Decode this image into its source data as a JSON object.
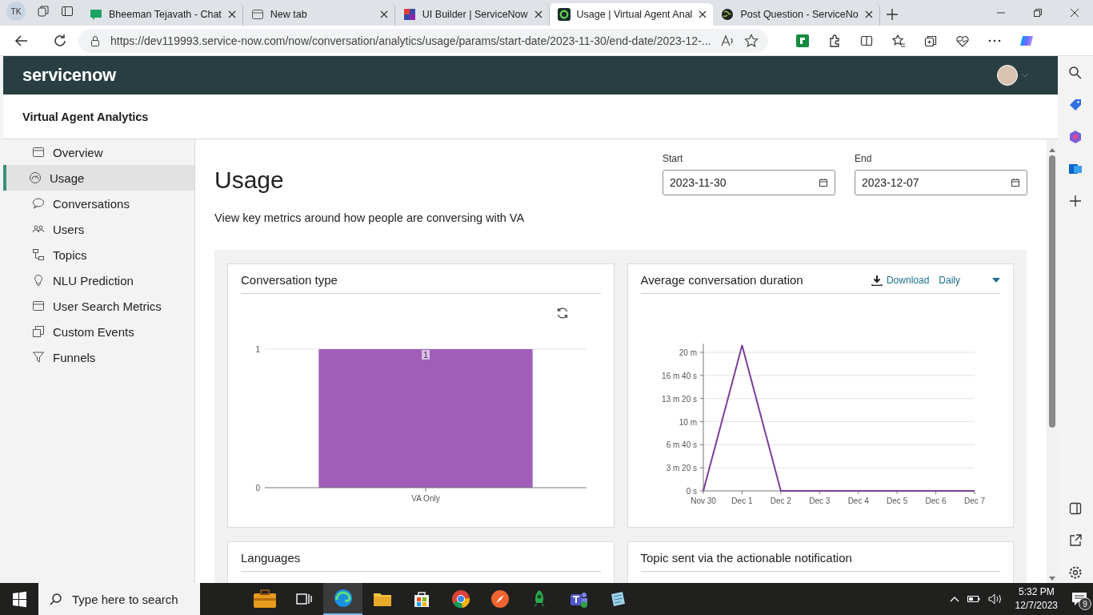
{
  "browser": {
    "profile": "TK",
    "tabs": [
      {
        "title": "Bheeman Tejavath - Chat",
        "kind": "chat",
        "selected": false
      },
      {
        "title": "New tab",
        "kind": "newtab",
        "selected": false
      },
      {
        "title": "UI Builder | ServiceNow",
        "kind": "builder",
        "selected": false
      },
      {
        "title": "Usage | Virtual Agent Anal",
        "kind": "servicenow",
        "selected": true
      },
      {
        "title": "Post Question - ServiceNo",
        "kind": "community",
        "selected": false
      }
    ],
    "address": "https://dev119993.service-now.com/now/conversation/analytics/usage/params/start-date/2023-11-30/end-date/2023-12-..."
  },
  "app": {
    "brand": "servicenow",
    "title": "Virtual Agent Analytics",
    "nav": [
      {
        "label": "Overview",
        "kind": "panel",
        "selected": false
      },
      {
        "label": "Usage",
        "kind": "gauge",
        "selected": true
      },
      {
        "label": "Conversations",
        "kind": "bubble",
        "selected": false
      },
      {
        "label": "Users",
        "kind": "users",
        "selected": false
      },
      {
        "label": "Topics",
        "kind": "topics",
        "selected": false
      },
      {
        "label": "NLU Prediction",
        "kind": "bulb",
        "selected": false
      },
      {
        "label": "User Search Metrics",
        "kind": "panel",
        "selected": false
      },
      {
        "label": "Custom Events",
        "kind": "events",
        "selected": false
      },
      {
        "label": "Funnels",
        "kind": "funnel",
        "selected": false
      }
    ],
    "page": {
      "heading": "Usage",
      "description": "View key metrics around how people are conversing with VA",
      "start": {
        "label": "Start",
        "value": "2023-11-30"
      },
      "end": {
        "label": "End",
        "value": "2023-12-07"
      }
    },
    "cards": [
      {
        "title": "Conversation type",
        "chart_data": {
          "type": "bar",
          "categories": [
            "VA Only"
          ],
          "series": [
            {
              "color": "#a05eb8",
              "values": [
                1
              ]
            }
          ],
          "ylim": [
            0,
            1
          ],
          "yticks": [
            0,
            1
          ],
          "grid": true,
          "data_labels": true
        }
      },
      {
        "title": "Average conversation duration",
        "download": "Download",
        "interval": "Daily",
        "chart_data": {
          "type": "line",
          "categories": [
            "Nov 30",
            "Dec 1",
            "Dec 2",
            "Dec 3",
            "Dec 4",
            "Dec 5",
            "Dec 6",
            "Dec 7"
          ],
          "grid": true,
          "series": [
            {
              "color": "#7b3f98",
              "values": [
                0,
                21,
                0,
                0,
                0,
                0,
                0,
                0
              ]
            }
          ],
          "ylim": [
            0,
            21
          ],
          "yticks": [
            {
              "value": 0,
              "label": "0 s"
            },
            {
              "value": 3.333,
              "label": "3 m 20 s"
            },
            {
              "value": 6.667,
              "label": "6 m 40 s"
            },
            {
              "value": 10,
              "label": "10 m"
            },
            {
              "value": 13.333,
              "label": "13 m 20 s"
            },
            {
              "value": 16.667,
              "label": "16 m 40 s"
            },
            {
              "value": 20,
              "label": "20 m"
            }
          ]
        }
      },
      {
        "title": "Languages"
      },
      {
        "title": "Topic sent via the actionable notification"
      }
    ]
  },
  "taskbar": {
    "search_placeholder": "Type here to search",
    "time": "5:32 PM",
    "date": "12/7/2023",
    "notifications": "9"
  }
}
